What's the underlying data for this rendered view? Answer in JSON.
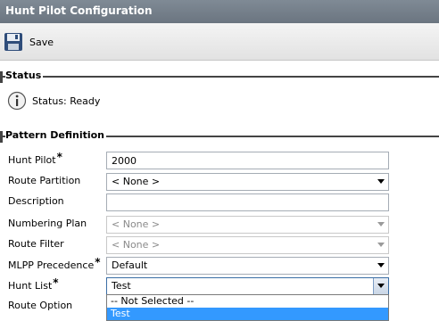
{
  "window": {
    "title": "Hunt Pilot Configuration"
  },
  "toolbar": {
    "save_label": "Save"
  },
  "status_section": {
    "heading": "Status",
    "status_text": "Status: Ready"
  },
  "pattern_section": {
    "heading": "Pattern Definition",
    "fields": {
      "hunt_pilot": {
        "label": "Hunt Pilot",
        "required": "*",
        "value": "2000"
      },
      "route_partition": {
        "label": "Route Partition",
        "value": "< None >"
      },
      "description": {
        "label": "Description",
        "value": ""
      },
      "numbering_plan": {
        "label": "Numbering Plan",
        "value": "< None >"
      },
      "route_filter": {
        "label": "Route Filter",
        "value": "< None >"
      },
      "mlpp_precedence": {
        "label": "MLPP Precedence",
        "required": "*",
        "value": "Default"
      },
      "hunt_list": {
        "label": "Hunt List",
        "required": "*",
        "value": "Test",
        "options": [
          "-- Not Selected --",
          "Test"
        ]
      },
      "route_option": {
        "label": "Route Option"
      }
    }
  },
  "colors": {
    "title_bar": "#77818c",
    "selection": "#3399ff"
  },
  "icons": {
    "save": "floppy-disk-icon",
    "status": "info-icon",
    "dropdown": "chevron-down-icon"
  }
}
